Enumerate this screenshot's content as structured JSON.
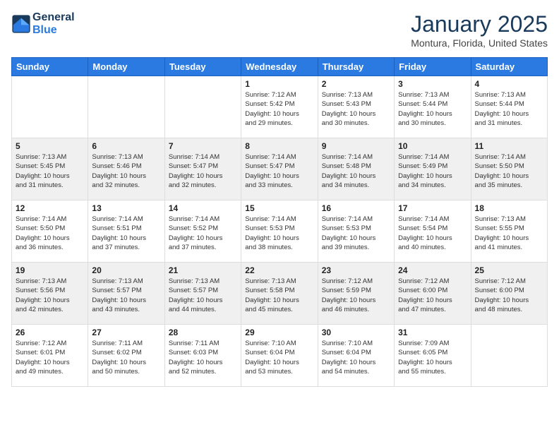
{
  "logo": {
    "text_general": "General",
    "text_blue": "Blue"
  },
  "header": {
    "month_year": "January 2025",
    "location": "Montura, Florida, United States"
  },
  "weekdays": [
    "Sunday",
    "Monday",
    "Tuesday",
    "Wednesday",
    "Thursday",
    "Friday",
    "Saturday"
  ],
  "weeks": [
    [
      {
        "day": "",
        "info": ""
      },
      {
        "day": "",
        "info": ""
      },
      {
        "day": "",
        "info": ""
      },
      {
        "day": "1",
        "info": "Sunrise: 7:12 AM\nSunset: 5:42 PM\nDaylight: 10 hours\nand 29 minutes."
      },
      {
        "day": "2",
        "info": "Sunrise: 7:13 AM\nSunset: 5:43 PM\nDaylight: 10 hours\nand 30 minutes."
      },
      {
        "day": "3",
        "info": "Sunrise: 7:13 AM\nSunset: 5:44 PM\nDaylight: 10 hours\nand 30 minutes."
      },
      {
        "day": "4",
        "info": "Sunrise: 7:13 AM\nSunset: 5:44 PM\nDaylight: 10 hours\nand 31 minutes."
      }
    ],
    [
      {
        "day": "5",
        "info": "Sunrise: 7:13 AM\nSunset: 5:45 PM\nDaylight: 10 hours\nand 31 minutes."
      },
      {
        "day": "6",
        "info": "Sunrise: 7:13 AM\nSunset: 5:46 PM\nDaylight: 10 hours\nand 32 minutes."
      },
      {
        "day": "7",
        "info": "Sunrise: 7:14 AM\nSunset: 5:47 PM\nDaylight: 10 hours\nand 32 minutes."
      },
      {
        "day": "8",
        "info": "Sunrise: 7:14 AM\nSunset: 5:47 PM\nDaylight: 10 hours\nand 33 minutes."
      },
      {
        "day": "9",
        "info": "Sunrise: 7:14 AM\nSunset: 5:48 PM\nDaylight: 10 hours\nand 34 minutes."
      },
      {
        "day": "10",
        "info": "Sunrise: 7:14 AM\nSunset: 5:49 PM\nDaylight: 10 hours\nand 34 minutes."
      },
      {
        "day": "11",
        "info": "Sunrise: 7:14 AM\nSunset: 5:50 PM\nDaylight: 10 hours\nand 35 minutes."
      }
    ],
    [
      {
        "day": "12",
        "info": "Sunrise: 7:14 AM\nSunset: 5:50 PM\nDaylight: 10 hours\nand 36 minutes."
      },
      {
        "day": "13",
        "info": "Sunrise: 7:14 AM\nSunset: 5:51 PM\nDaylight: 10 hours\nand 37 minutes."
      },
      {
        "day": "14",
        "info": "Sunrise: 7:14 AM\nSunset: 5:52 PM\nDaylight: 10 hours\nand 37 minutes."
      },
      {
        "day": "15",
        "info": "Sunrise: 7:14 AM\nSunset: 5:53 PM\nDaylight: 10 hours\nand 38 minutes."
      },
      {
        "day": "16",
        "info": "Sunrise: 7:14 AM\nSunset: 5:53 PM\nDaylight: 10 hours\nand 39 minutes."
      },
      {
        "day": "17",
        "info": "Sunrise: 7:14 AM\nSunset: 5:54 PM\nDaylight: 10 hours\nand 40 minutes."
      },
      {
        "day": "18",
        "info": "Sunrise: 7:13 AM\nSunset: 5:55 PM\nDaylight: 10 hours\nand 41 minutes."
      }
    ],
    [
      {
        "day": "19",
        "info": "Sunrise: 7:13 AM\nSunset: 5:56 PM\nDaylight: 10 hours\nand 42 minutes."
      },
      {
        "day": "20",
        "info": "Sunrise: 7:13 AM\nSunset: 5:57 PM\nDaylight: 10 hours\nand 43 minutes."
      },
      {
        "day": "21",
        "info": "Sunrise: 7:13 AM\nSunset: 5:57 PM\nDaylight: 10 hours\nand 44 minutes."
      },
      {
        "day": "22",
        "info": "Sunrise: 7:13 AM\nSunset: 5:58 PM\nDaylight: 10 hours\nand 45 minutes."
      },
      {
        "day": "23",
        "info": "Sunrise: 7:12 AM\nSunset: 5:59 PM\nDaylight: 10 hours\nand 46 minutes."
      },
      {
        "day": "24",
        "info": "Sunrise: 7:12 AM\nSunset: 6:00 PM\nDaylight: 10 hours\nand 47 minutes."
      },
      {
        "day": "25",
        "info": "Sunrise: 7:12 AM\nSunset: 6:00 PM\nDaylight: 10 hours\nand 48 minutes."
      }
    ],
    [
      {
        "day": "26",
        "info": "Sunrise: 7:12 AM\nSunset: 6:01 PM\nDaylight: 10 hours\nand 49 minutes."
      },
      {
        "day": "27",
        "info": "Sunrise: 7:11 AM\nSunset: 6:02 PM\nDaylight: 10 hours\nand 50 minutes."
      },
      {
        "day": "28",
        "info": "Sunrise: 7:11 AM\nSunset: 6:03 PM\nDaylight: 10 hours\nand 52 minutes."
      },
      {
        "day": "29",
        "info": "Sunrise: 7:10 AM\nSunset: 6:04 PM\nDaylight: 10 hours\nand 53 minutes."
      },
      {
        "day": "30",
        "info": "Sunrise: 7:10 AM\nSunset: 6:04 PM\nDaylight: 10 hours\nand 54 minutes."
      },
      {
        "day": "31",
        "info": "Sunrise: 7:09 AM\nSunset: 6:05 PM\nDaylight: 10 hours\nand 55 minutes."
      },
      {
        "day": "",
        "info": ""
      }
    ]
  ]
}
